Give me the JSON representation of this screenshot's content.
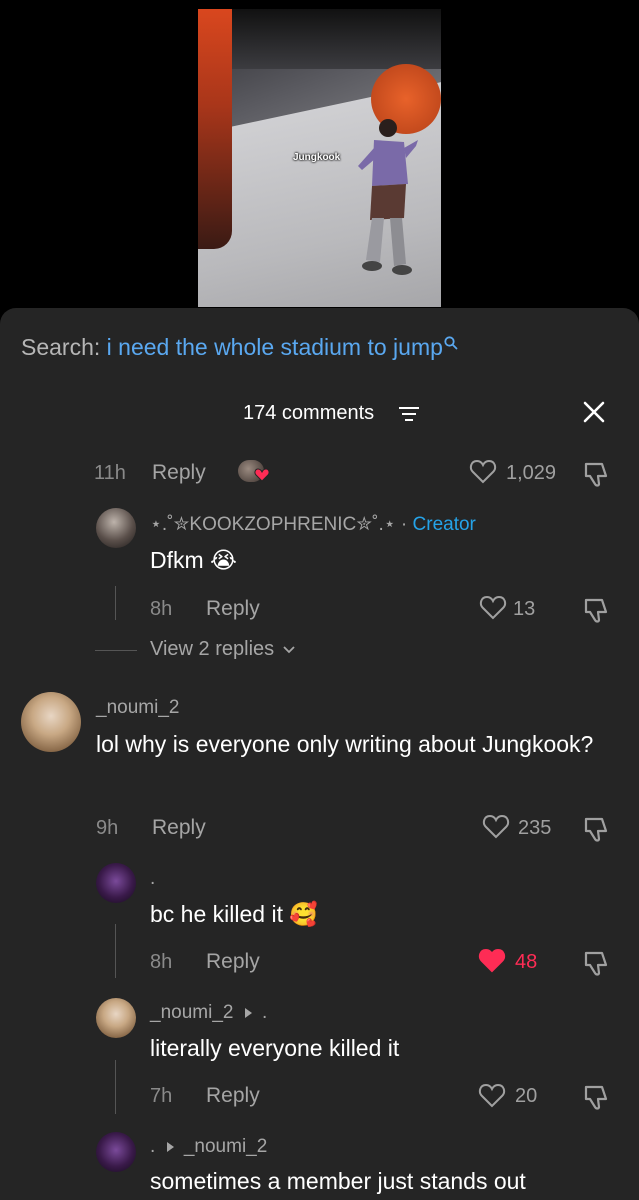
{
  "video": {
    "tag_label": "Jungkook"
  },
  "search": {
    "label": "Search:",
    "term": "i need the whole stadium to jump"
  },
  "header": {
    "comments_label": "174 comments"
  },
  "top_partial": {
    "time": "11h",
    "reply_label": "Reply",
    "likes": "1,029"
  },
  "comments": [
    {
      "username": "⋆.˚✮KOOKZOPHRENIC✮˚.⋆",
      "badge": "Creator",
      "text": "Dfkm 😭",
      "time": "8h",
      "reply_label": "Reply",
      "likes": "13",
      "view_replies": "View 2 replies"
    },
    {
      "username": "_noumi_2",
      "text": "lol why is everyone only writing about Jungkook?",
      "time": "9h",
      "reply_label": "Reply",
      "likes": "235"
    },
    {
      "username": ".",
      "text": "bc he killed it 🥰",
      "time": "8h",
      "reply_label": "Reply",
      "likes": "48",
      "liked": true
    },
    {
      "username": "_noumi_2",
      "reply_to": ".",
      "text": "literally everyone killed it",
      "time": "7h",
      "reply_label": "Reply",
      "likes": "20"
    },
    {
      "username": ".",
      "reply_to": "_noumi_2",
      "text": "sometimes a member just stands out"
    }
  ],
  "colors": {
    "sheet_bg": "#252525",
    "accent_blue": "#5aa8f0",
    "creator_blue": "#25a3e8",
    "like_red": "#fe2c55"
  }
}
